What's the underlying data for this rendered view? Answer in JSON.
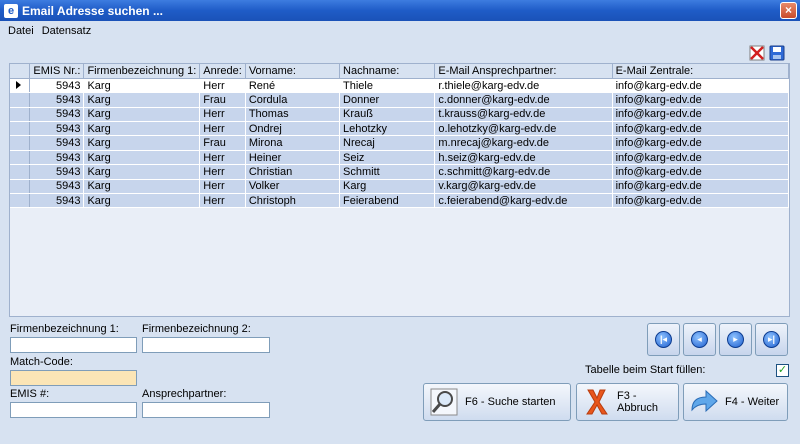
{
  "window": {
    "title": "Email Adresse suchen ...",
    "close_glyph": "×"
  },
  "menu": [
    {
      "label": "Datei"
    },
    {
      "label": "Datensatz"
    }
  ],
  "toolbar": {
    "icons": [
      "delete-icon",
      "save-icon"
    ]
  },
  "grid": {
    "columns": [
      "EMIS Nr.:",
      "Firmenbezeichnung 1:",
      "Anrede:",
      "Vorname:",
      "Nachname:",
      "E-Mail Ansprechpartner:",
      "E-Mail Zentrale:"
    ],
    "rows": [
      {
        "emis": "5943",
        "firma": "Karg",
        "anrede": "Herr",
        "vorname": "René",
        "nachname": "Thiele",
        "email": "r.thiele@karg-edv.de",
        "zentrale": "info@karg-edv.de"
      },
      {
        "emis": "5943",
        "firma": "Karg",
        "anrede": "Frau",
        "vorname": "Cordula",
        "nachname": "Donner",
        "email": "c.donner@karg-edv.de",
        "zentrale": "info@karg-edv.de"
      },
      {
        "emis": "5943",
        "firma": "Karg",
        "anrede": "Herr",
        "vorname": "Thomas",
        "nachname": "Krauß",
        "email": "t.krauss@karg-edv.de",
        "zentrale": "info@karg-edv.de"
      },
      {
        "emis": "5943",
        "firma": "Karg",
        "anrede": "Herr",
        "vorname": "Ondrej",
        "nachname": "Lehotzky",
        "email": "o.lehotzky@karg-edv.de",
        "zentrale": "info@karg-edv.de"
      },
      {
        "emis": "5943",
        "firma": "Karg",
        "anrede": "Frau",
        "vorname": "Mirona",
        "nachname": "Nrecaj",
        "email": "m.nrecaj@karg-edv.de",
        "zentrale": "info@karg-edv.de"
      },
      {
        "emis": "5943",
        "firma": "Karg",
        "anrede": "Herr",
        "vorname": "Heiner",
        "nachname": "Seiz",
        "email": "h.seiz@karg-edv.de",
        "zentrale": "info@karg-edv.de"
      },
      {
        "emis": "5943",
        "firma": "Karg",
        "anrede": "Herr",
        "vorname": "Christian",
        "nachname": "Schmitt",
        "email": "c.schmitt@karg-edv.de",
        "zentrale": "info@karg-edv.de"
      },
      {
        "emis": "5943",
        "firma": "Karg",
        "anrede": "Herr",
        "vorname": "Volker",
        "nachname": "Karg",
        "email": "v.karg@karg-edv.de",
        "zentrale": "info@karg-edv.de"
      },
      {
        "emis": "5943",
        "firma": "Karg",
        "anrede": "Herr",
        "vorname": "Christoph",
        "nachname": "Feierabend",
        "email": "c.feierabend@karg-edv.de",
        "zentrale": "info@karg-edv.de"
      }
    ],
    "selected_row": 0
  },
  "form": {
    "firma1_label": "Firmenbezeichnung 1:",
    "firma1_value": "",
    "firma2_label": "Firmenbezeichnung 2:",
    "firma2_value": "",
    "match_label": "Match-Code:",
    "match_value": "",
    "emis_label": "EMIS #:",
    "emis_value": "",
    "ansprech_label": "Ansprechpartner:",
    "ansprech_value": ""
  },
  "nav": {
    "icons": [
      "first-record-icon",
      "previous-record-icon",
      "next-record-icon",
      "last-record-icon"
    ]
  },
  "options": {
    "fill_on_start_label": "Tabelle beim Start füllen:",
    "fill_on_start_checked": true
  },
  "buttons": {
    "search_label": "F6 - Suche starten",
    "cancel_label": "F3 - Abbruch",
    "next_label": "F4 - Weiter"
  },
  "colors": {
    "titlebar": "#1f5cc7",
    "window_bg": "#d7e2f1",
    "row_bg": "#c7d5ec",
    "match_bg": "#fbe5b6"
  }
}
